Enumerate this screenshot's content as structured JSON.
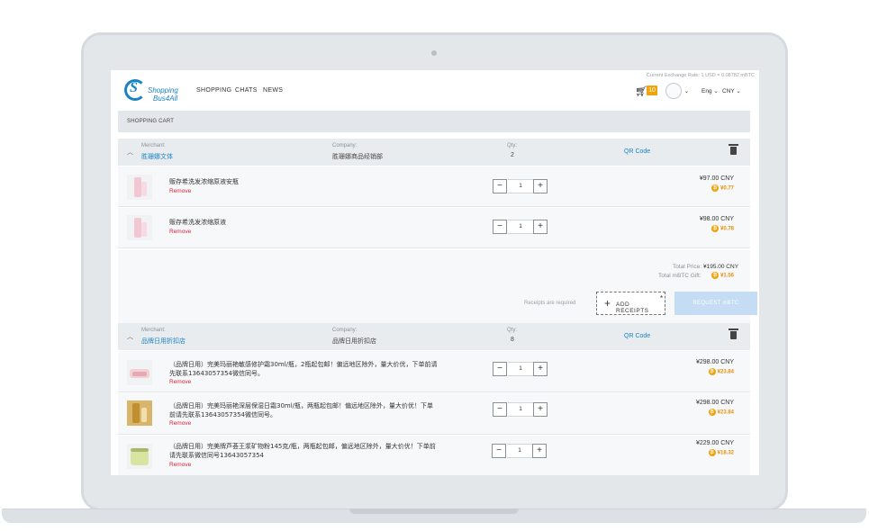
{
  "header": {
    "brand_line1": "Shopping",
    "brand_line2": "Bus4All",
    "logo_mark": "S",
    "nav": [
      "SHOPPING",
      "CHATS",
      "NEWS"
    ],
    "exchange_rate": "Current Exchange Rate: 1 USD = 0.08782 mBTC",
    "cart_count": "10",
    "language": "Eng",
    "currency": "CNY"
  },
  "cart": {
    "title": "SHOPPING CART",
    "merchant_label": "Merchant:",
    "company_label": "Company:",
    "qty_label": "Qty:",
    "qr_label": "QR Code",
    "remove_label": "Remove",
    "merchants": [
      {
        "merchant": "胜珊娜文体",
        "company": "胜珊娜商品经销部",
        "qty": "2",
        "items": [
          {
            "name": "贩存希洗发浓缩原液安瓶",
            "qty": "1",
            "price": "¥97.00 CNY",
            "mbtc": "¥0.77"
          },
          {
            "name": "贩存希洗发浓缩原液",
            "qty": "1",
            "price": "¥98.00 CNY",
            "mbtc": "¥0.78"
          }
        ],
        "totals": {
          "total_price_label": "Total Price:",
          "total_price": "¥195.00 CNY",
          "total_mbtc_label": "Total mBTC Gift:",
          "total_mbtc": "¥1.56"
        },
        "receipts_note": "Receipts are required",
        "add_receipts": "ADD RECEIPTS",
        "request_mbtc": "REQUEST mBTC"
      },
      {
        "merchant": "品牌日用折扣店",
        "company": "品牌日用折扣店",
        "qty": "8",
        "items": [
          {
            "name": "（品牌日用）完美玛丽艳敏感修护霜30ml/瓶，2瓶起包邮！偏远地区除外，量大价优，下单前请先联系13643057354微信同号。",
            "qty": "1",
            "price": "¥298.00 CNY",
            "mbtc": "¥23.84"
          },
          {
            "name": "（品牌日用）完美玛丽艳深层保湿日霜30ml/瓶，两瓶起包邮！偏远地区除外，量大价优！下单前请先联系13643057354微信同号。",
            "qty": "1",
            "price": "¥298.00 CNY",
            "mbtc": "¥23.84"
          },
          {
            "name": "（品牌日用）完美牌芦荟王浆矿物粉145克/瓶，两瓶起包邮，偏远地区除外，量大价优！下单前请先联系微信同号13643057354",
            "qty": "1",
            "price": "¥229.00 CNY",
            "mbtc": "¥18.32"
          }
        ]
      }
    ]
  },
  "colors": {
    "brand_blue": "#1a83c6",
    "remove_red": "#d7243c",
    "mbtc_orange": "#e8900c",
    "request_button": "#c4dcf4"
  }
}
